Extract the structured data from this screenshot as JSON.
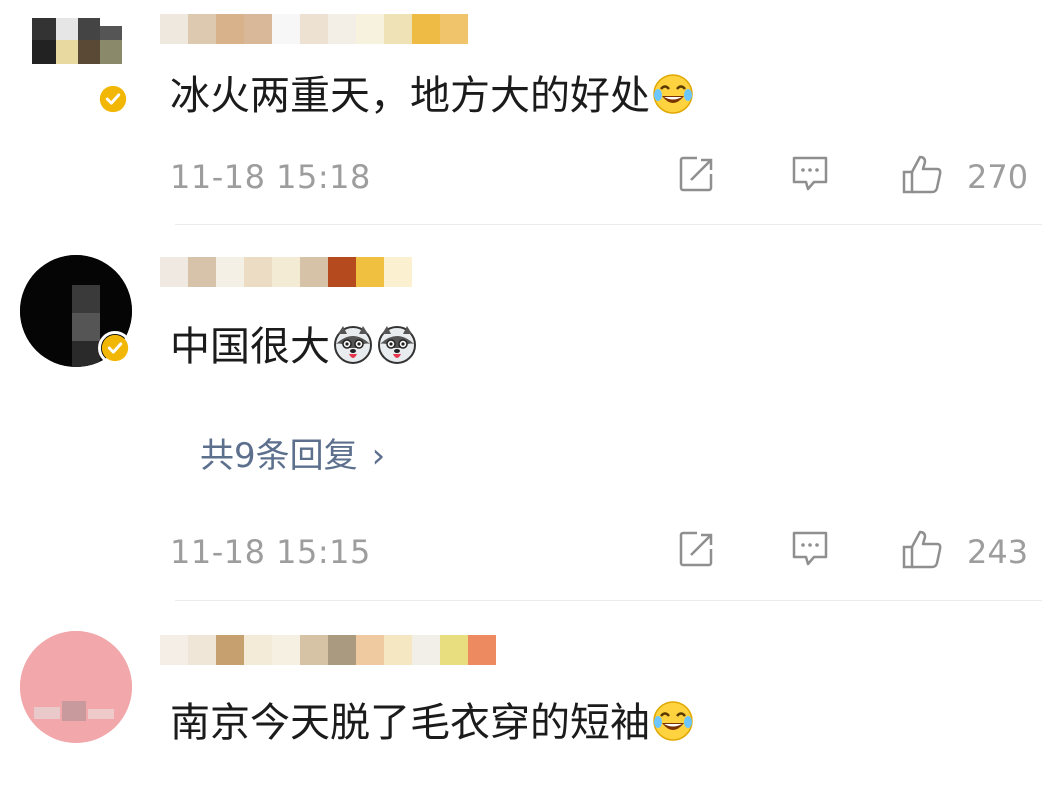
{
  "comments": [
    {
      "text": "冰火两重天，地方大的好处",
      "emoji": "laughing-tears-emoji",
      "time": "11-18 15:18",
      "likes": "270",
      "verified": true
    },
    {
      "text": "中国很大",
      "emoji": "husky-emoji",
      "time": "11-18 15:15",
      "likes": "243",
      "verified": true,
      "replies_label": "共9条回复",
      "replies_chevron": "›"
    },
    {
      "text": "南京今天脱了毛衣穿的短袖",
      "emoji": "laughing-tears-emoji",
      "verified": false
    }
  ],
  "icons": {
    "share": "share-icon",
    "comment": "comment-icon",
    "like": "thumbs-up-icon",
    "verified": "verified-badge-icon"
  },
  "colors": {
    "meta_gray": "#9d9d9d",
    "link_blue": "#5c6f8d",
    "badge_gold": "#f2b705",
    "text": "#1b1b1b"
  }
}
